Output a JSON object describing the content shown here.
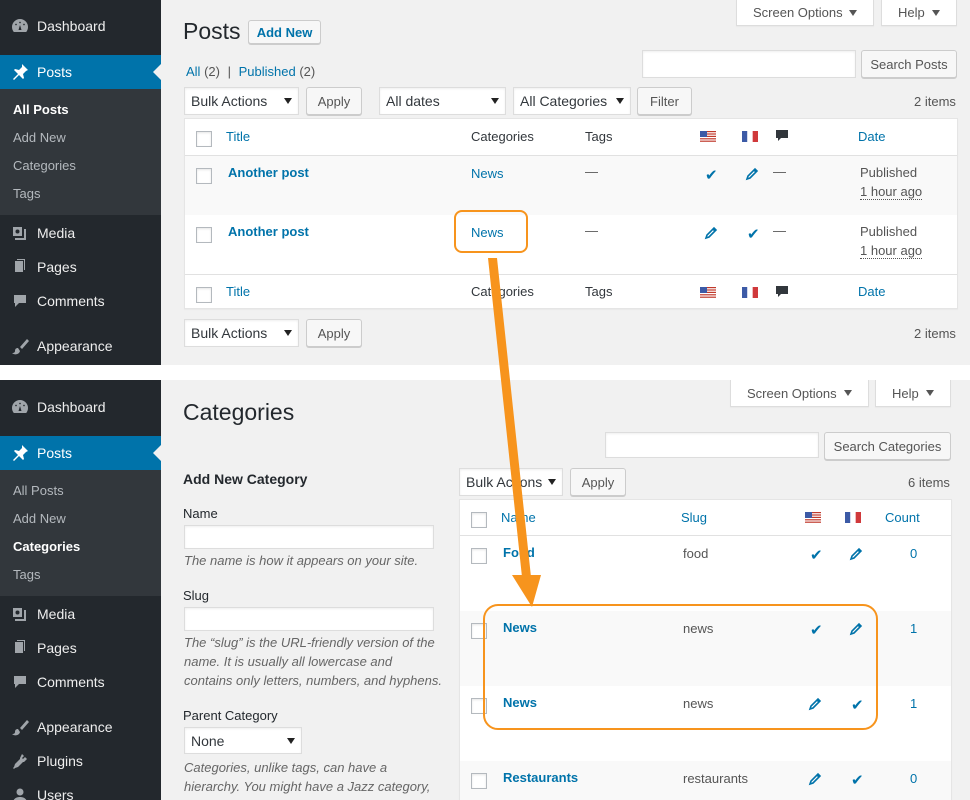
{
  "colors": {
    "sidebar": "#23282d",
    "accent": "#0073aa",
    "highlight": "#f7941d",
    "background": "#f1f1f1"
  },
  "sidebar_top": {
    "items": [
      {
        "label": "Dashboard",
        "icon": "dashboard-icon"
      },
      {
        "label": "Posts",
        "icon": "pin-icon"
      },
      {
        "label": "Media",
        "icon": "media-icon"
      },
      {
        "label": "Pages",
        "icon": "pages-icon"
      },
      {
        "label": "Comments",
        "icon": "comment-icon"
      },
      {
        "label": "Appearance",
        "icon": "brush-icon"
      }
    ],
    "submenu": [
      "All Posts",
      "Add New",
      "Categories",
      "Tags"
    ]
  },
  "posts_screen": {
    "title": "Posts",
    "add_new": "Add New",
    "screen_options": "Screen Options",
    "help": "Help",
    "views": {
      "all": "All",
      "all_count": "(2)",
      "separator": "|",
      "published": "Published",
      "published_count": "(2)"
    },
    "search_button": "Search Posts",
    "bulk_actions": "Bulk Actions",
    "apply": "Apply",
    "dates_filter": "All dates",
    "categories_filter": "All Categories",
    "filter": "Filter",
    "items_count": "2 items",
    "columns": {
      "title": "Title",
      "categories": "Categories",
      "tags": "Tags",
      "date": "Date"
    },
    "rows": [
      {
        "title": "Another post",
        "category": "News",
        "tags": "—",
        "comments": "—",
        "status": "Published",
        "time": "1 hour ago"
      },
      {
        "title": "Another post",
        "category": "News",
        "tags": "—",
        "comments": "—",
        "status": "Published",
        "time": "1 hour ago"
      }
    ]
  },
  "sidebar_bottom": {
    "items": [
      {
        "label": "Dashboard",
        "icon": "dashboard-icon"
      },
      {
        "label": "Posts",
        "icon": "pin-icon"
      },
      {
        "label": "Media",
        "icon": "media-icon"
      },
      {
        "label": "Pages",
        "icon": "pages-icon"
      },
      {
        "label": "Comments",
        "icon": "comment-icon"
      },
      {
        "label": "Appearance",
        "icon": "brush-icon"
      },
      {
        "label": "Plugins",
        "icon": "plug-icon"
      },
      {
        "label": "Users",
        "icon": "user-icon"
      }
    ],
    "submenu": [
      "All Posts",
      "Add New",
      "Categories",
      "Tags"
    ]
  },
  "categories_screen": {
    "title": "Categories",
    "screen_options": "Screen Options",
    "help": "Help",
    "search_button": "Search Categories",
    "form": {
      "heading": "Add New Category",
      "name_label": "Name",
      "name_help": "The name is how it appears on your site.",
      "slug_label": "Slug",
      "slug_help": "The “slug” is the URL-friendly version of the name. It is usually all lowercase and contains only letters, numbers, and hyphens.",
      "parent_label": "Parent Category",
      "parent_value": "None",
      "parent_help": "Categories, unlike tags, can have a hierarchy. You might have a Jazz category, and under"
    },
    "bulk_actions": "Bulk Actions",
    "apply": "Apply",
    "items_count": "6 items",
    "columns": {
      "name": "Name",
      "slug": "Slug",
      "count": "Count"
    },
    "rows": [
      {
        "name": "Food",
        "slug": "food",
        "count": "0"
      },
      {
        "name": "News",
        "slug": "news",
        "count": "1"
      },
      {
        "name": "News",
        "slug": "news",
        "count": "1"
      },
      {
        "name": "Restaurants",
        "slug": "restaurants",
        "count": "0"
      }
    ]
  }
}
